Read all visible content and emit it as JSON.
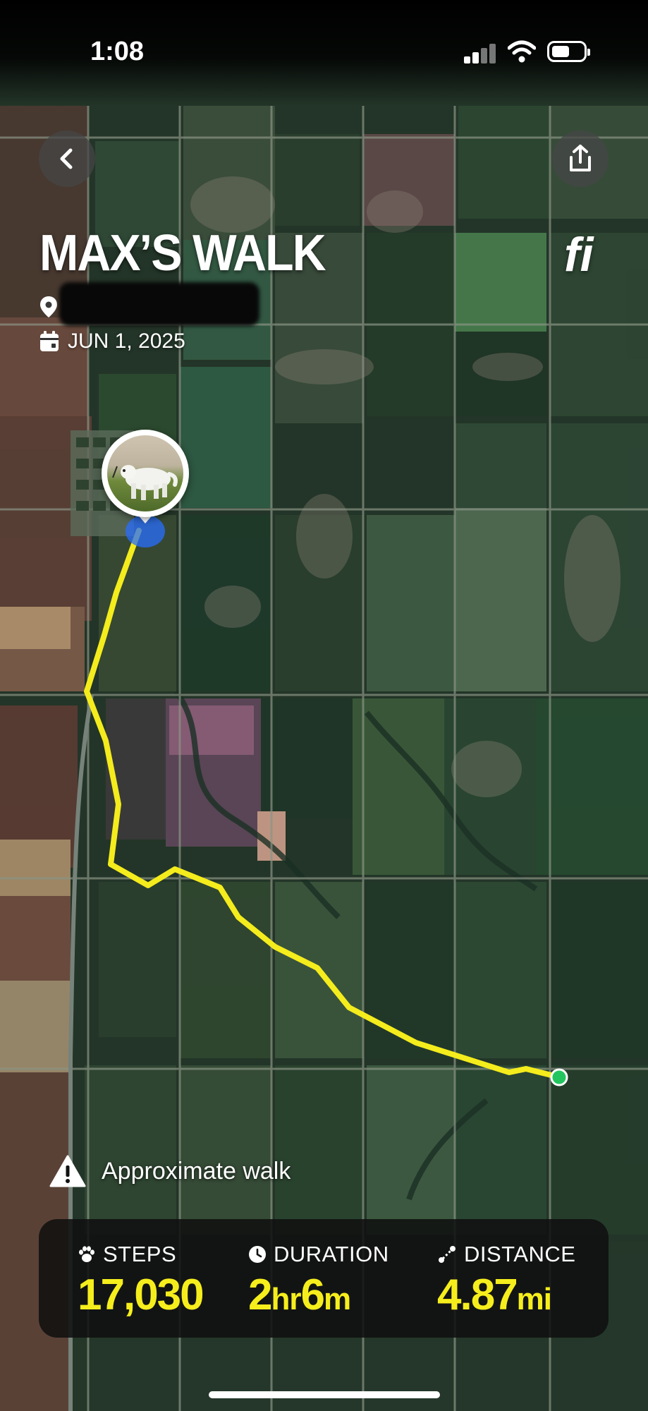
{
  "status_bar": {
    "time": "1:08"
  },
  "header": {
    "title": "MAX’S WALK",
    "brand_logo": "fi",
    "date": "JUN 1, 2025"
  },
  "map": {
    "notice": "Approximate walk",
    "route_color": "#f4ec1c",
    "end_marker_color": "#22c55e",
    "start_marker_color": "#2f6bff"
  },
  "stats": {
    "steps": {
      "label": "STEPS",
      "value": "17,030"
    },
    "duration": {
      "label": "DURATION",
      "hours": "2",
      "hours_unit": "hr",
      "minutes": "6",
      "minutes_unit": "m"
    },
    "distance": {
      "label": "DISTANCE",
      "value": "4.87",
      "unit": "mi"
    },
    "value_color": "#f6ee1c"
  },
  "icons": [
    "back-icon",
    "share-icon",
    "location-pin-icon",
    "calendar-icon",
    "warning-icon",
    "paw-icon",
    "clock-icon",
    "distance-icon"
  ]
}
